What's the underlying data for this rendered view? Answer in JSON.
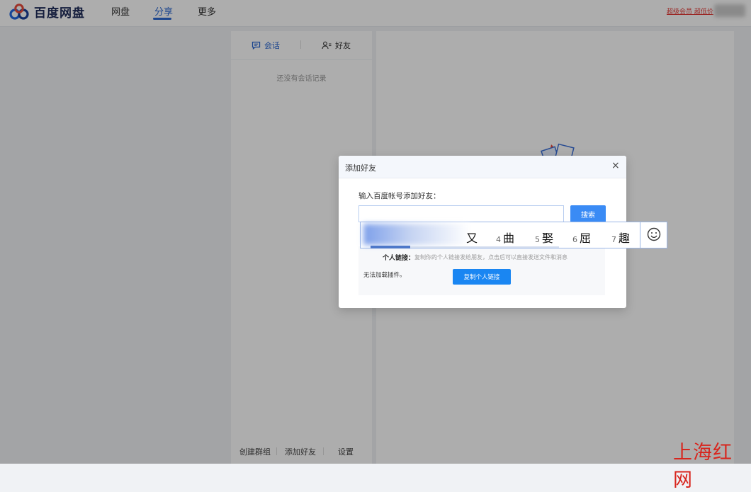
{
  "header": {
    "logo_text": "百度网盘",
    "nav": [
      {
        "label": "网盘",
        "active": false
      },
      {
        "label": "分享",
        "active": true
      },
      {
        "label": "更多",
        "active": false
      }
    ],
    "vip_link": "超级会员 超低价"
  },
  "sidebar": {
    "tabs": [
      {
        "label": "会话",
        "icon": "chat-icon",
        "active": true
      },
      {
        "label": "好友",
        "icon": "friends-icon",
        "active": false
      }
    ],
    "empty_message": "还没有会话记录",
    "footer_buttons": [
      "创建群组",
      "添加好友",
      "设置"
    ]
  },
  "dialog": {
    "title": "添加好友",
    "close_symbol": "×",
    "input_label": "输入百度帐号添加好友：",
    "input_value": "",
    "search_button": "搜索",
    "personal_link_label": "个人链接：",
    "personal_link_desc": "复制你的个人链接发给朋友，点击后可以直接发送文件和消息",
    "plugin_note": "无法加载插件。",
    "copy_button": "复制个人链接"
  },
  "ime": {
    "candidates": [
      {
        "num": "",
        "char": "又"
      },
      {
        "num": "4",
        "char": "曲"
      },
      {
        "num": "5",
        "char": "娶"
      },
      {
        "num": "6",
        "char": "屈"
      },
      {
        "num": "7",
        "char": "趣"
      }
    ],
    "emoji_icon": "smiley-icon"
  },
  "watermark": "上海红网",
  "colors": {
    "accent": "#2b67d1",
    "button_blue": "#1a86f2",
    "watermark_red": "#d8251d"
  }
}
